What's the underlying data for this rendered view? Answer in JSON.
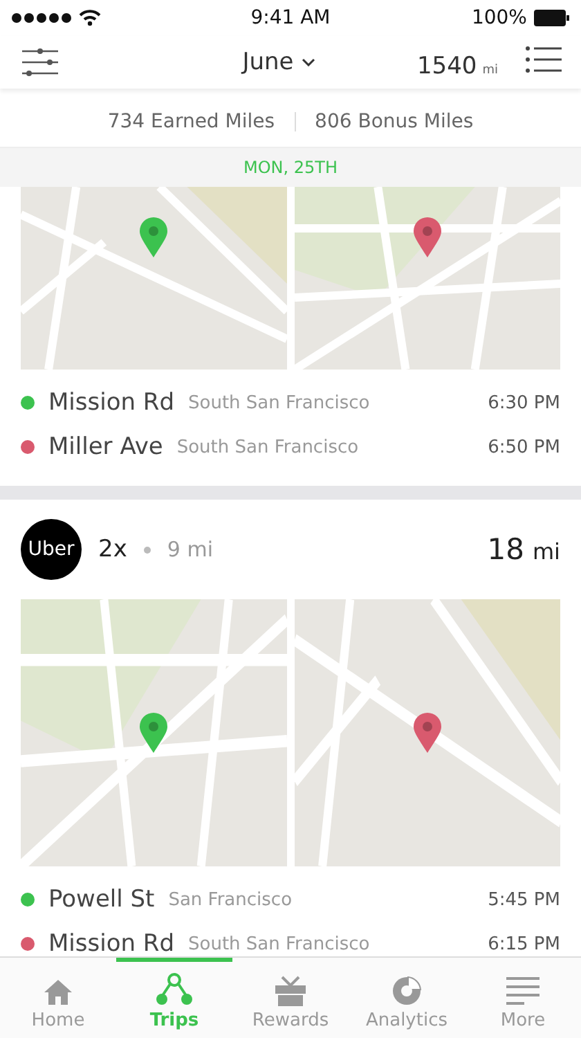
{
  "status_bar": {
    "time": "9:41 AM",
    "battery": "100%"
  },
  "nav": {
    "month": "June",
    "total": "1540",
    "unit": "mi"
  },
  "summary": {
    "earned": "734 Earned Miles",
    "bonus": "806 Bonus Miles"
  },
  "date": "MON, 25TH",
  "trips": [
    {
      "stops": [
        {
          "kind": "start",
          "place": "Mission Rd",
          "city": "South San Francisco",
          "time": "6:30 PM"
        },
        {
          "kind": "end",
          "place": "Miller Ave",
          "city": "South San Francisco",
          "time": "6:50 PM"
        }
      ]
    },
    {
      "header": {
        "logo": "Uber",
        "multiplier": "2x",
        "sub": "9 mi",
        "distance": "18",
        "unit": "mi"
      },
      "stops": [
        {
          "kind": "start",
          "place": "Powell St",
          "city": "San Francisco",
          "time": "5:45 PM"
        },
        {
          "kind": "end",
          "place": "Mission Rd",
          "city": "South San Francisco",
          "time": "6:15 PM"
        }
      ]
    }
  ],
  "tabs": [
    {
      "label": "Home",
      "selected": false
    },
    {
      "label": "Trips",
      "selected": true
    },
    {
      "label": "Rewards",
      "selected": false
    },
    {
      "label": "Analytics",
      "selected": false
    },
    {
      "label": "More",
      "selected": false
    }
  ]
}
